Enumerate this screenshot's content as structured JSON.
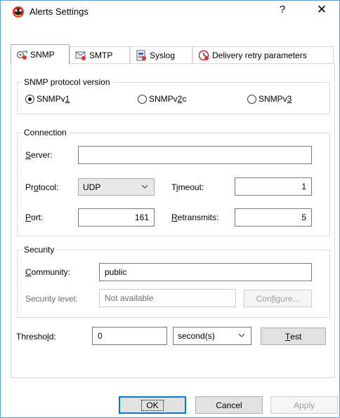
{
  "window": {
    "title": "Alerts Settings",
    "help_label": "?",
    "close_label": "✕"
  },
  "tabs": [
    {
      "label": "SNMP",
      "icon": "snmp-icon",
      "active": true
    },
    {
      "label": "SMTP",
      "icon": "mail-icon",
      "active": false
    },
    {
      "label": "Syslog",
      "icon": "log-icon",
      "active": false
    },
    {
      "label": "Delivery retry parameters",
      "icon": "retry-icon",
      "active": false
    }
  ],
  "snmp_version": {
    "title": "SNMP protocol version",
    "options": [
      {
        "pre": "SNMPv",
        "key": "1",
        "post": "",
        "selected": true
      },
      {
        "pre": "SNMPv",
        "key": "2",
        "post": "c",
        "selected": false
      },
      {
        "pre": "SNMPv",
        "key": "3",
        "post": "",
        "selected": false
      }
    ]
  },
  "connection": {
    "title": "Connection",
    "server_key": "S",
    "server_rest": "erver:",
    "server_value": "",
    "protocol_pre": "Pr",
    "protocol_key": "o",
    "protocol_rest": "tocol:",
    "protocol_value": "UDP",
    "timeout_pre": "T",
    "timeout_key": "i",
    "timeout_rest": "meout:",
    "timeout_value": "1",
    "port_key": "P",
    "port_rest": "ort:",
    "port_value": "161",
    "retransmits_key": "R",
    "retransmits_rest": "etransmits:",
    "retransmits_value": "5"
  },
  "security": {
    "title": "Security",
    "community_key": "C",
    "community_rest": "ommunity:",
    "community_value": "public",
    "level_label": "Security level:",
    "level_value": "Not available",
    "configure_pre": "Con",
    "configure_key": "f",
    "configure_rest": "igure..."
  },
  "threshold": {
    "pre": "Thresho",
    "key": "l",
    "rest": "d:",
    "value": "0",
    "unit": "second(s)",
    "test_key": "T",
    "test_rest": "est"
  },
  "footer": {
    "ok": "OK",
    "cancel": "Cancel",
    "apply": "Apply"
  }
}
